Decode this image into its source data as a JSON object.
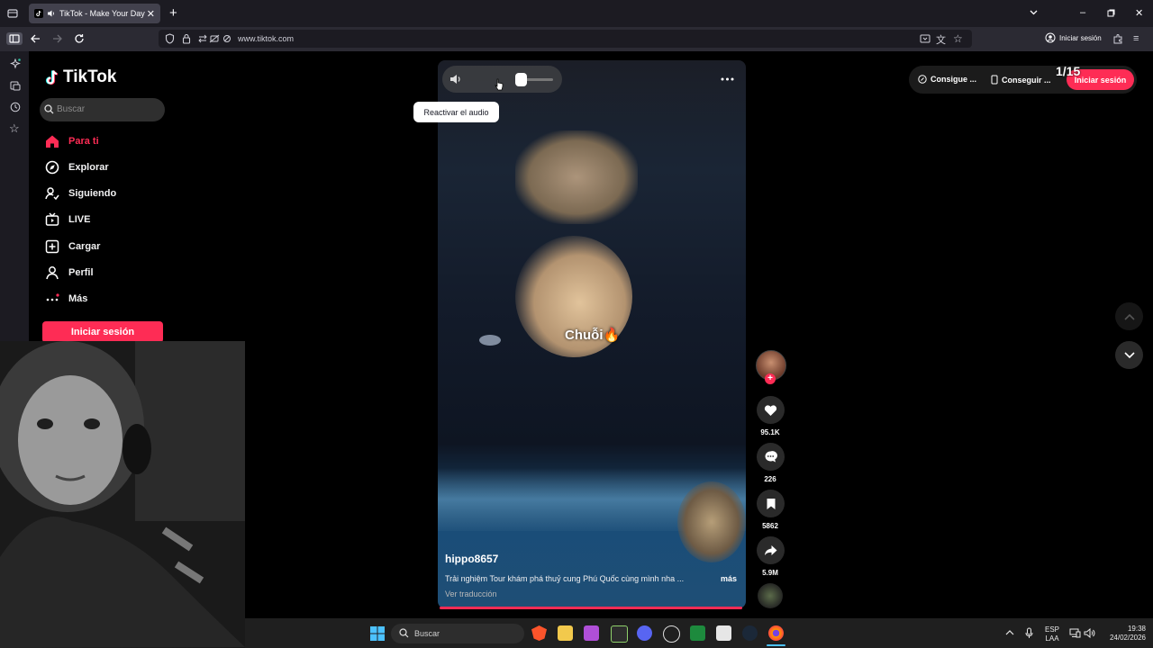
{
  "browser": {
    "tab_title": "TikTok - Make Your Day",
    "url": "www.tiktok.com",
    "login_label": "Iniciar sesión"
  },
  "tiktok": {
    "logo_text": "TikTok",
    "search_placeholder": "Buscar",
    "nav": [
      {
        "label": "Para ti",
        "icon": "home-icon",
        "active": true
      },
      {
        "label": "Explorar",
        "icon": "compass-icon"
      },
      {
        "label": "Siguiendo",
        "icon": "following-icon"
      },
      {
        "label": "LIVE",
        "icon": "live-tv-icon"
      },
      {
        "label": "Cargar",
        "icon": "upload-icon"
      },
      {
        "label": "Perfil",
        "icon": "profile-icon"
      },
      {
        "label": "Más",
        "icon": "more-icon"
      }
    ],
    "login_button": "Iniciar sesión",
    "video": {
      "tooltip": "Reactivar el audio",
      "overlay_caption": "Chuỗi🔥",
      "author": "hippo8657",
      "description": "Trải nghiệm Tour khám phá thuỷ cung Phú Quốc cùng mình nha ...",
      "more_label": "más",
      "translate_label": "Ver traducción",
      "volume_level": 0.0
    },
    "actions": {
      "likes": "95.1K",
      "comments": "226",
      "saves": "5862",
      "shares": "5.9M"
    },
    "top_right": {
      "btn1": "Consigue ...",
      "btn2": "Conseguir ...",
      "login": "Iniciar sesión",
      "counter": "1/15"
    }
  },
  "taskbar": {
    "search_label": "Buscar",
    "lang_top": "ESP",
    "lang_bottom": "LAA",
    "time": "19:38",
    "date": "24/02/2026"
  },
  "colors": {
    "accent": "#fe2c55",
    "background": "#000000",
    "chrome": "#2b2a33"
  }
}
